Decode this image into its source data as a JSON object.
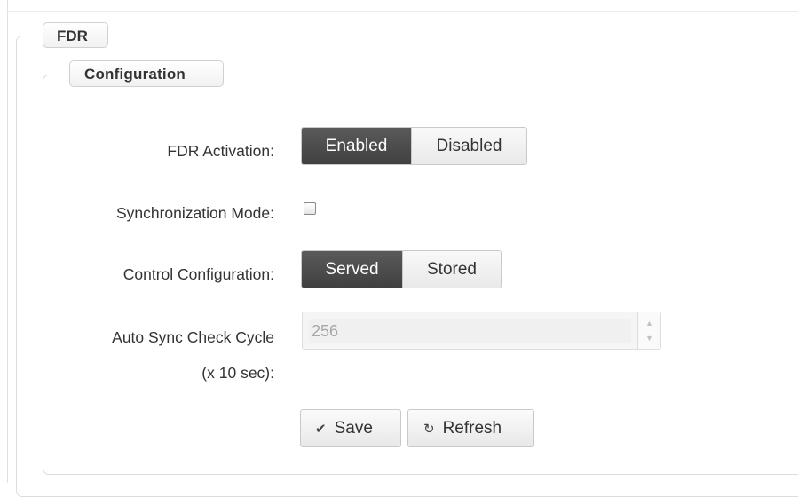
{
  "fieldset": {
    "legend": "FDR"
  },
  "configuration": {
    "legend": "Configuration",
    "fdr_activation": {
      "label": "FDR Activation:",
      "options": [
        "Enabled",
        "Disabled"
      ],
      "selected": "Enabled"
    },
    "sync_mode": {
      "label": "Synchronization Mode:",
      "checked": false
    },
    "control_configuration": {
      "label": "Control Configuration:",
      "options": [
        "Served",
        "Stored"
      ],
      "selected": "Served"
    },
    "auto_sync": {
      "label_line1": "Auto Sync Check Cycle",
      "label_line2": "(x 10 sec):",
      "value": "256",
      "disabled": true
    }
  },
  "actions": {
    "save": {
      "label": "Save",
      "icon": "check-icon"
    },
    "refresh": {
      "label": "Refresh",
      "icon": "refresh-icon"
    }
  }
}
